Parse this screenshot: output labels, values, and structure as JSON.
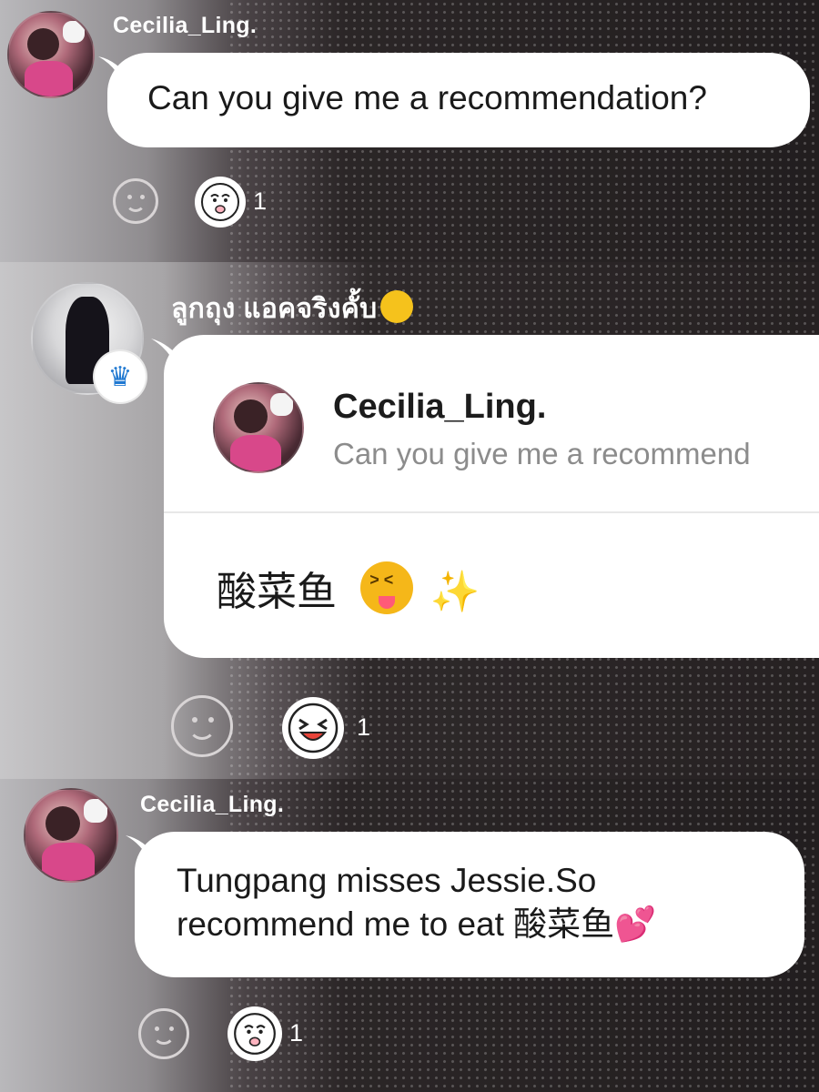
{
  "panels": [
    {
      "username": "Cecilia_Ling.",
      "message": "Can you give me a recommendation?",
      "reaction_count": "1"
    },
    {
      "username": "ลูกถุง แอคจริงคั้บ",
      "reply_to": {
        "username": "Cecilia_Ling.",
        "quote": "Can you give me a recommend"
      },
      "message": "酸菜鱼",
      "reaction_count": "1"
    },
    {
      "username": "Cecilia_Ling.",
      "message_line1": "Tungpang misses Jessie.So",
      "message_line2": "recommend me to eat 酸菜鱼",
      "reaction_count": "1"
    }
  ],
  "icons": {
    "add_reaction": "smiley-outline-icon",
    "reaction_worried": "worried-face-icon",
    "reaction_laugh": "laughing-face-icon",
    "crown": "crown-icon",
    "zany_face": "zany-face-emoji",
    "tongue_face": "squinting-tongue-emoji",
    "sparkles": "sparkles-emoji",
    "hearts": "two-hearts-emoji"
  },
  "colors": {
    "bubble": "#ffffff",
    "crown": "#1f78d1",
    "username": "#ffffff",
    "quote": "#8c8c8c"
  }
}
